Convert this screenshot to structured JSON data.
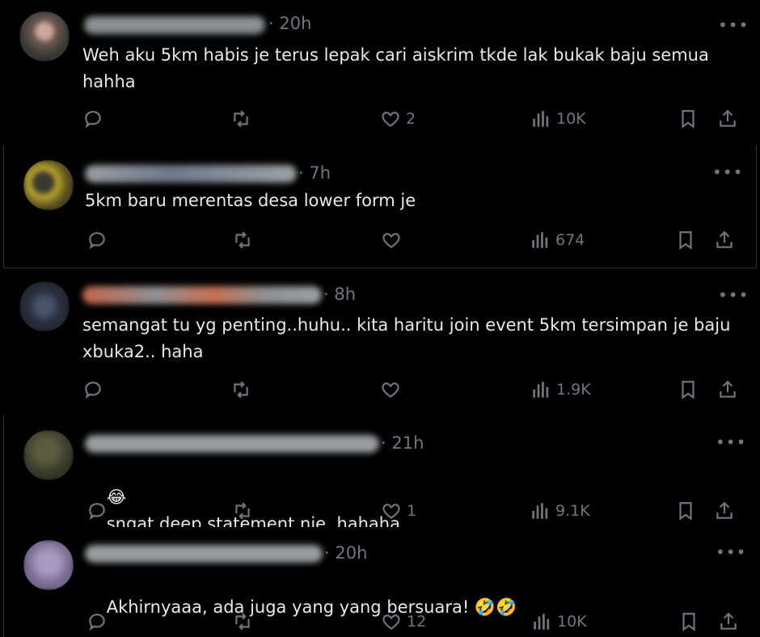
{
  "replies": [
    {
      "time": "· 20h",
      "text": "Weh aku 5km habis je terus lepak cari aiskrim tkde lak bukak baju semua\nhahha",
      "likes": "2",
      "views": "10K",
      "more": "•••"
    },
    {
      "time": "· 7h",
      "text": "5km baru merentas desa lower form je",
      "likes": "",
      "views": "674",
      "more": "•••"
    },
    {
      "time": "· 8h",
      "text": "semangat tu yg penting..huhu.. kita haritu join event 5km tersimpan je baju\nxbuka2.. haha",
      "likes": "",
      "views": "1.9K",
      "more": "•••"
    },
    {
      "time": "· 21h",
      "emoji": "😂",
      "text": "sngat deep statement nie. hahaha",
      "likes": "1",
      "views": "9.1K",
      "more": "•••"
    },
    {
      "time": "· 20h",
      "text": "Akhirnyaaa, ada juga yang yang bersuara! ",
      "emoji_after": "🤣🤣",
      "likes": "12",
      "views": "10K",
      "more": "•••"
    }
  ],
  "colors": {
    "background": "#000000",
    "text": "#e7e9ea",
    "muted": "#71767b",
    "divider": "#2f3336"
  },
  "icons": [
    "reply-icon",
    "retweet-icon",
    "like-icon",
    "views-icon",
    "bookmark-icon",
    "share-icon",
    "more-icon"
  ]
}
